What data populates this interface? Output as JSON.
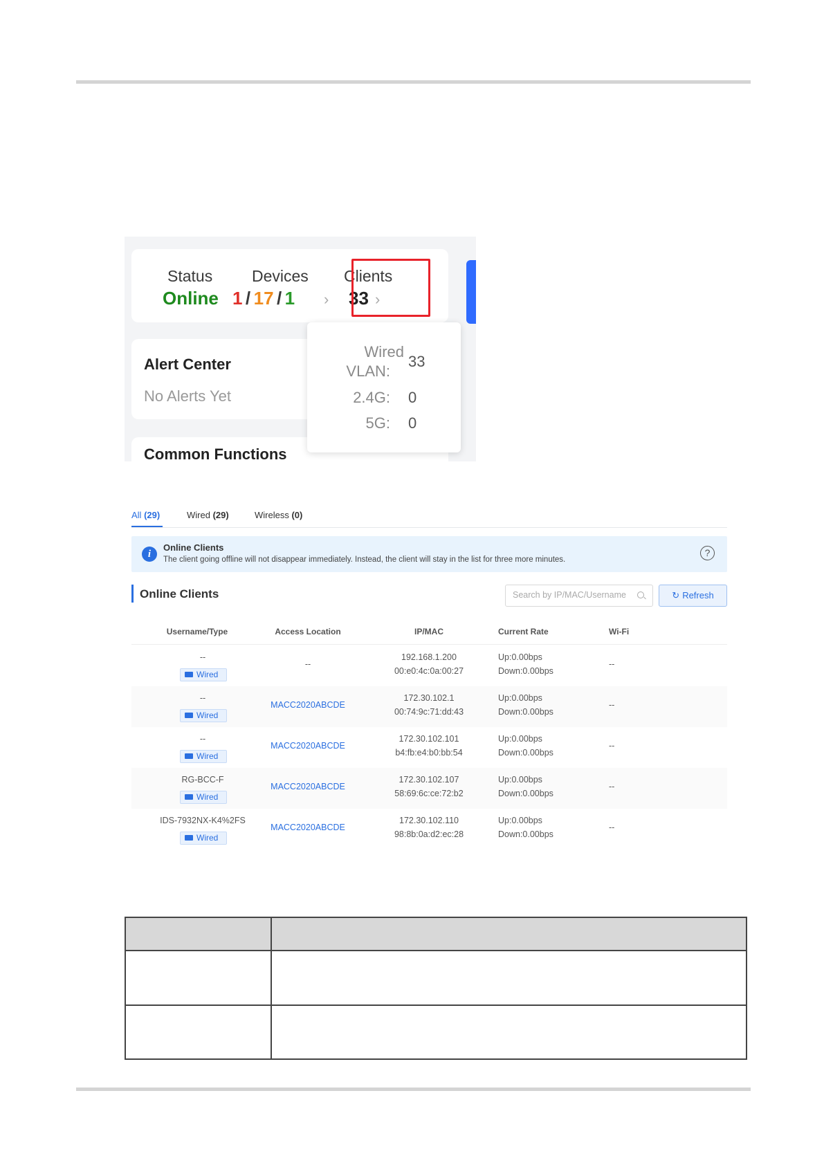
{
  "dashboard": {
    "status_label": "Status",
    "status_value": "Online",
    "devices_label": "Devices",
    "devices_red": "1",
    "devices_orange": "17",
    "devices_green": "1",
    "devices_sep": "/",
    "clients_label": "Clients",
    "clients_value": "33",
    "alert_title": "Alert Center",
    "alert_text": "No Alerts Yet",
    "common_title": "Common Functions",
    "popup": {
      "wired_label_1": "Wired",
      "wired_label_2": "VLAN:",
      "wired_value": "33",
      "g24_label": "2.4G:",
      "g24_value": "0",
      "g5_label": "5G:",
      "g5_value": "0"
    },
    "colors": {
      "online": "#1e8a1e",
      "red": "#e0302a",
      "orange": "#f08c1e",
      "green": "#2a9a2a",
      "highlight": "#e8222a"
    }
  },
  "clients_panel": {
    "tabs": [
      {
        "label": "All",
        "count": "(29)"
      },
      {
        "label": "Wired",
        "count": "(29)"
      },
      {
        "label": "Wireless",
        "count": "(0)"
      }
    ],
    "notice_title": "Online Clients",
    "notice_text": "The client going offline will not disappear immediately. Instead, the client will stay in the list for three more minutes.",
    "section_title": "Online Clients",
    "search_placeholder": "Search by IP/MAC/Username",
    "refresh_label": "Refresh",
    "columns": [
      "Username/Type",
      "Access Location",
      "IP/MAC",
      "Current Rate",
      "Wi-Fi"
    ],
    "rows": [
      {
        "username": "--",
        "type": "Wired",
        "location": "--",
        "ip": "192.168.1.200",
        "mac": "00:e0:4c:0a:00:27",
        "up": "Up:0.00bps",
        "down": "Down:0.00bps",
        "wifi": "--"
      },
      {
        "username": "--",
        "type": "Wired",
        "location": "MACC2020ABCDE",
        "ip": "172.30.102.1",
        "mac": "00:74:9c:71:dd:43",
        "up": "Up:0.00bps",
        "down": "Down:0.00bps",
        "wifi": "--"
      },
      {
        "username": "--",
        "type": "Wired",
        "location": "MACC2020ABCDE",
        "ip": "172.30.102.101",
        "mac": "b4:fb:e4:b0:bb:54",
        "up": "Up:0.00bps",
        "down": "Down:0.00bps",
        "wifi": "--"
      },
      {
        "username": "RG-BCC-F",
        "type": "Wired",
        "location": "MACC2020ABCDE",
        "ip": "172.30.102.107",
        "mac": "58:69:6c:ce:72:b2",
        "up": "Up:0.00bps",
        "down": "Down:0.00bps",
        "wifi": "--"
      },
      {
        "username": "IDS-7932NX-K4%2FS",
        "type": "Wired",
        "location": "MACC2020ABCDE",
        "ip": "172.30.102.110",
        "mac": "98:8b:0a:d2:ec:28",
        "up": "Up:0.00bps",
        "down": "Down:0.00bps",
        "wifi": "--"
      }
    ],
    "accent": "#2a6fe0"
  },
  "icons": [
    "chevron-right-icon",
    "info-icon",
    "help-icon",
    "search-icon",
    "refresh-icon",
    "wired-icon"
  ]
}
